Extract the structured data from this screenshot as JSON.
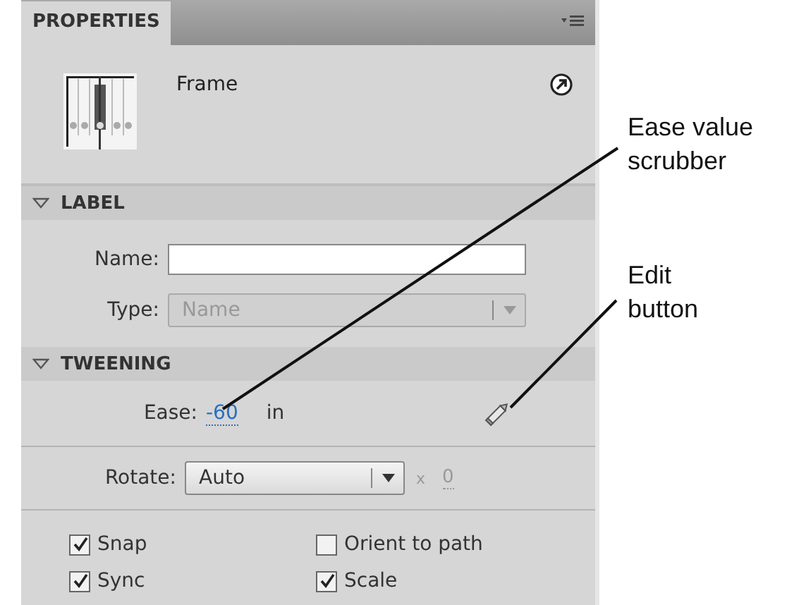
{
  "tab": {
    "label": "PROPERTIES",
    "selected": true
  },
  "frame": {
    "title": "Frame"
  },
  "label_section": {
    "title": "LABEL",
    "expanded": true,
    "name_label": "Name:",
    "type": {
      "label": "Type:",
      "value": "Name",
      "disabled": true
    }
  },
  "tweening_section": {
    "title": "TWEENING",
    "expanded": true,
    "ease": {
      "label": "Ease:",
      "value": "-60",
      "unit": "in"
    },
    "rotate": {
      "label": "Rotate:",
      "value": "Auto",
      "times": "x",
      "count": "0"
    },
    "options": [
      {
        "label": "Snap",
        "checked": true
      },
      {
        "label": "Orient to path",
        "checked": false
      },
      {
        "label": "Sync",
        "checked": true
      },
      {
        "label": "Scale",
        "checked": true
      }
    ]
  },
  "callouts": [
    {
      "text": "Ease value scrubber"
    },
    {
      "text": "Edit button"
    }
  ]
}
